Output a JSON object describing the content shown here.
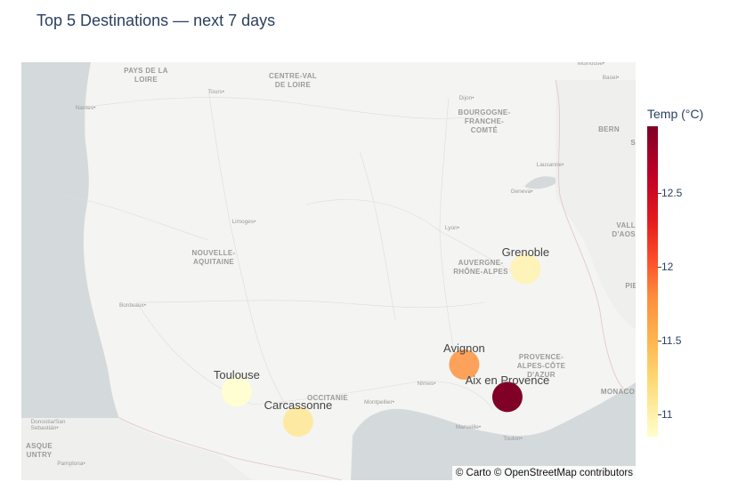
{
  "title": "Top 5 Destinations — next 7 days",
  "attribution": "© Carto © OpenStreetMap contributors",
  "colorbar": {
    "title": "Temp (°C)",
    "colorscale": [
      "#ffffcc",
      "#fed976",
      "#feb24c",
      "#fd8d3c",
      "#fc4e2a",
      "#e31a1c",
      "#bd0026",
      "#800026"
    ],
    "range": [
      10.85,
      12.95
    ],
    "ticks": [
      "11",
      "11.5",
      "12",
      "12.5"
    ]
  },
  "destinations": [
    {
      "name": "Grenoble",
      "lat": 45.19,
      "lon": 5.72,
      "temp": 10.95
    },
    {
      "name": "Avignon",
      "lat": 43.95,
      "lon": 4.81,
      "temp": 11.7
    },
    {
      "name": "Aix en Provence",
      "lat": 43.53,
      "lon": 5.45,
      "temp": 12.95
    },
    {
      "name": "Toulouse",
      "lat": 43.6,
      "lon": 1.44,
      "temp": 10.85
    },
    {
      "name": "Carcassonne",
      "lat": 43.21,
      "lon": 2.35,
      "temp": 11.05
    }
  ],
  "basemap": {
    "regions": [
      {
        "text": "PAYS DE LA\nLOIRE"
      },
      {
        "text": "CENTRE-VAL\nDE LOIRE"
      },
      {
        "text": "BOURGOGNE-\nFRANCHE-\nCOMTÉ"
      },
      {
        "text": "NOUVELLE-\nAQUITAINE"
      },
      {
        "text": "AUVERGNE-\nRHÔNE-ALPES"
      },
      {
        "text": "OCCITANIE"
      },
      {
        "text": "PROVENCE-\nALPES-CÔTE\nD'AZUR"
      },
      {
        "text": "VALLE\nD'AOSTA"
      },
      {
        "text": "PIEMO"
      },
      {
        "text": "MONACO"
      },
      {
        "text": "BERN"
      },
      {
        "text": "SWIT"
      },
      {
        "text": "ASQUE\nUNTRY"
      }
    ],
    "cities": [
      {
        "text": "Nantes"
      },
      {
        "text": "Tours"
      },
      {
        "text": "Dijon"
      },
      {
        "text": "Limoges"
      },
      {
        "text": "Lyon"
      },
      {
        "text": "Geneva"
      },
      {
        "text": "Lausanne"
      },
      {
        "text": "Bordeaux"
      },
      {
        "text": "Nîmes"
      },
      {
        "text": "Montpellier"
      },
      {
        "text": "Marseille"
      },
      {
        "text": "Toulon"
      },
      {
        "text": "Mulhouse"
      },
      {
        "text": "Basel"
      },
      {
        "text": "Pamplona"
      },
      {
        "text": "Donostia/San\nSebastián"
      }
    ]
  }
}
